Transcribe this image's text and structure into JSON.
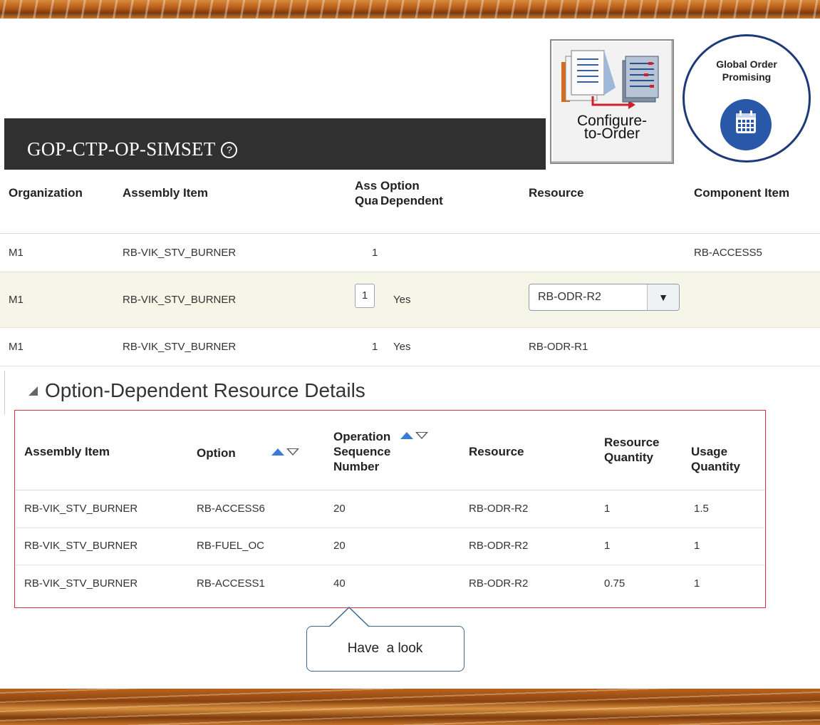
{
  "page_title": "GOP-CTP-OP-SIMSET",
  "badges": {
    "configure_to_order": "Configure-\nto-Order",
    "gop_line1": "Global Order",
    "gop_line2": "Promising"
  },
  "top_table": {
    "headers": {
      "organization": "Organization",
      "assembly_item": "Assembly Item",
      "assembly_qty_1": "Ass",
      "assembly_qty_2": "Qua",
      "option_dependent_1": "Option",
      "option_dependent_2": "Dependent",
      "resource": "Resource",
      "component_item": "Component Item"
    },
    "rows": [
      {
        "organization": "M1",
        "assembly_item": "RB-VIK_STV_BURNER",
        "quantity": "1",
        "option_dependent": "",
        "resource": "",
        "component_item": "RB-ACCESS5"
      },
      {
        "organization": "M1",
        "assembly_item": "RB-VIK_STV_BURNER",
        "quantity": "1",
        "option_dependent": "Yes",
        "resource": "RB-ODR-R2",
        "component_item": ""
      },
      {
        "organization": "M1",
        "assembly_item": "RB-VIK_STV_BURNER",
        "quantity": "1",
        "option_dependent": "Yes",
        "resource": "RB-ODR-R1",
        "component_item": ""
      }
    ]
  },
  "section": {
    "title": "Option-Dependent Resource Details"
  },
  "detail_table": {
    "headers": {
      "assembly_item": "Assembly Item",
      "option": "Option",
      "op_seq_1": "Operation",
      "op_seq_2": "Sequence",
      "op_seq_3": "Number",
      "resource": "Resource",
      "resource_qty_1": "Resource",
      "resource_qty_2": "Quantity",
      "usage_qty_1": "Usage",
      "usage_qty_2": "Quantity"
    },
    "rows": [
      {
        "assembly_item": "RB-VIK_STV_BURNER",
        "option": "RB-ACCESS6",
        "op_seq": "20",
        "resource": "RB-ODR-R2",
        "resource_qty": "1",
        "usage_qty": "1.5"
      },
      {
        "assembly_item": "RB-VIK_STV_BURNER",
        "option": "RB-FUEL_OC",
        "op_seq": "20",
        "resource": "RB-ODR-R2",
        "resource_qty": "1",
        "usage_qty": "1"
      },
      {
        "assembly_item": "RB-VIK_STV_BURNER",
        "option": "RB-ACCESS1",
        "op_seq": "40",
        "resource": "RB-ODR-R2",
        "resource_qty": "0.75",
        "usage_qty": "1"
      }
    ]
  },
  "callout": {
    "text": "Have  a look"
  },
  "colors": {
    "title_bar": "#303030",
    "highlight_box": "#e0303a",
    "sort_asc": "#3a7bd5",
    "selected_row": "#f6f6e8"
  }
}
